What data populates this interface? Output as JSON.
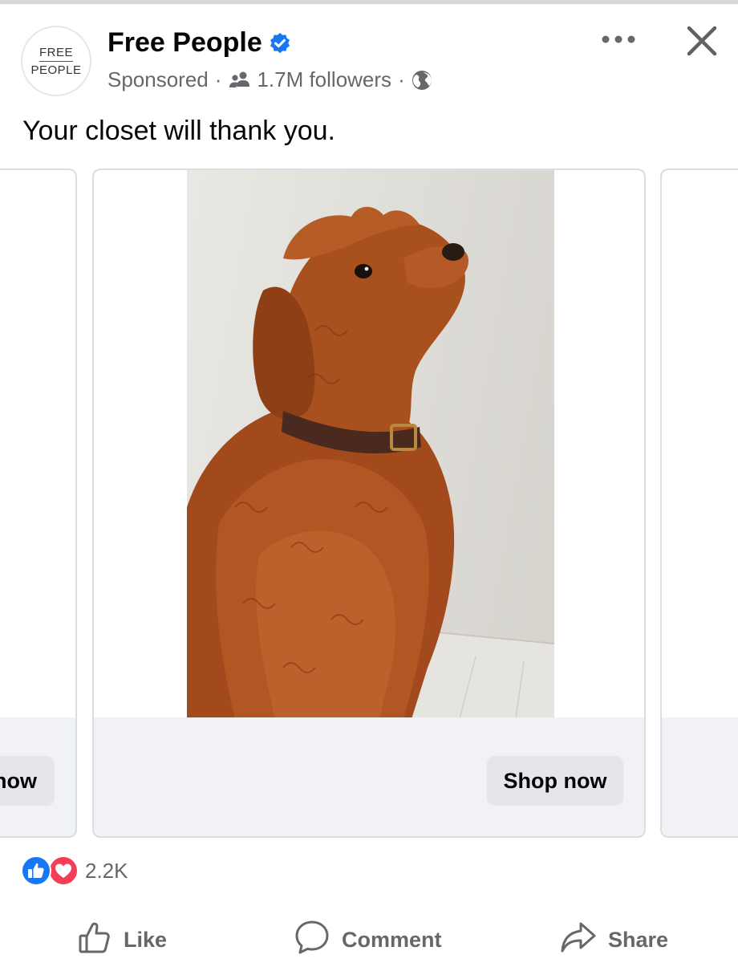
{
  "post": {
    "avatar_line1": "FREE",
    "avatar_line2": "PEOPLE",
    "page_name": "Free People",
    "sponsored": "Sponsored",
    "separator": "·",
    "followers": "1.7M followers",
    "caption": "Your closet will thank you."
  },
  "carousel": {
    "left_cta_partial": "now",
    "main_cta": "Shop now"
  },
  "reactions": {
    "count": "2.2K"
  },
  "actions": {
    "like": "Like",
    "comment": "Comment",
    "share": "Share"
  },
  "icons": {
    "verified": "verified-badge-icon",
    "followers": "people-icon",
    "audience": "globe-icon",
    "more": "more-options-icon",
    "close": "close-icon",
    "like_reaction": "thumbs-up-reaction-icon",
    "love_reaction": "heart-reaction-icon"
  },
  "colors": {
    "brand_blue": "#1877f2",
    "love_red": "#f33e58",
    "secondary_text": "#65676b",
    "button_gray": "#e4e6eb"
  }
}
